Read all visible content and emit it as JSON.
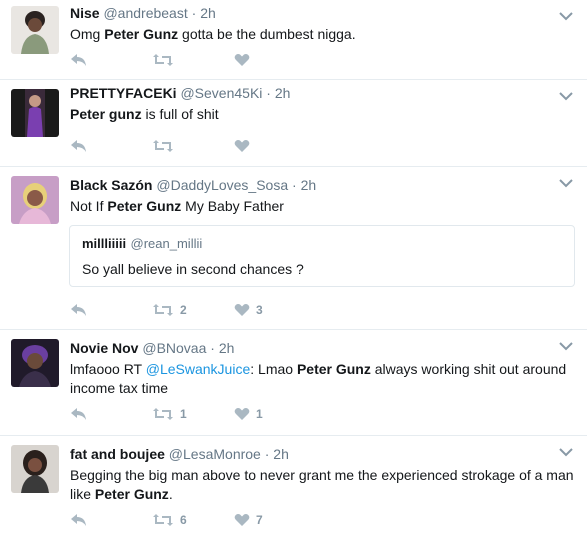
{
  "tweets": [
    {
      "name": "Nise",
      "handle": "@andrebeast",
      "sep": "·",
      "time": "2h",
      "text_parts": [
        "Omg ",
        "Peter Gunz",
        " gotta be the dumbest nigga."
      ],
      "retweets": "",
      "likes": ""
    },
    {
      "name": "PRETTYFACEKi",
      "handle": "@Seven45Ki",
      "sep": "·",
      "time": "2h",
      "text_parts": [
        "Peter gunz",
        " is full of shit"
      ],
      "retweets": "",
      "likes": ""
    },
    {
      "name": "Black Sazón",
      "handle": "@DaddyLoves_Sosa",
      "sep": "·",
      "time": "2h",
      "text_parts": [
        "Not If ",
        "Peter Gunz",
        " My Baby Father"
      ],
      "quote": {
        "name": "millliiiii",
        "handle": "@rean_millii",
        "text": "So yall believe in second chances ?"
      },
      "retweets": "2",
      "likes": "3"
    },
    {
      "name": "Novie Nov",
      "handle": "@BNovaa",
      "sep": "·",
      "time": "2h",
      "text_parts": [
        "lmfaooo RT ",
        "@LeSwankJuice",
        ": Lmao ",
        "Peter Gunz",
        " always working shit out around income tax time"
      ],
      "retweets": "1",
      "likes": "1"
    },
    {
      "name": "fat and boujee",
      "handle": "@LesaMonroe",
      "sep": "·",
      "time": "2h",
      "text_parts": [
        "Begging the big man above to never grant me the experienced strokage of a man like ",
        "Peter Gunz",
        "."
      ],
      "retweets": "6",
      "likes": "7"
    }
  ],
  "colors": {
    "link": "#1b95e0",
    "muted": "#657786",
    "icon": "#8899a6",
    "divider": "#e6ecf0"
  },
  "icons": {
    "reply": "reply-icon",
    "retweet": "retweet-icon",
    "like": "heart-icon",
    "more": "chevron-down-icon"
  }
}
